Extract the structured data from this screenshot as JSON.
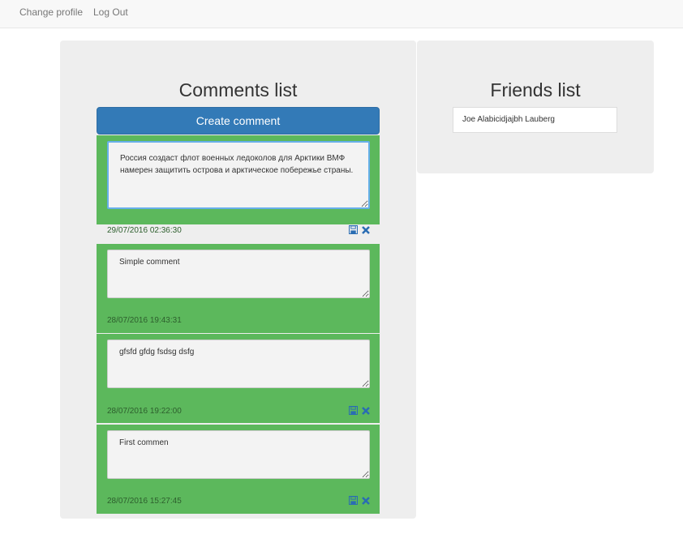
{
  "nav": {
    "change_profile": "Change profile",
    "log_out": "Log Out"
  },
  "comments_panel": {
    "title": "Comments list",
    "create_button": "Create comment",
    "items": [
      {
        "text": "Россия создаст флот военных ледоколов для Арктики ВМФ намерен защитить острова и арктическое побережье страны.",
        "date": "29/07/2016 02:36:30",
        "editable": true
      },
      {
        "text": "Simple comment",
        "date": "28/07/2016 19:43:31",
        "editable": false
      },
      {
        "text": "gfsfd gfdg fsdsg dsfg",
        "date": "28/07/2016 19:22:00",
        "editable": true
      },
      {
        "text": "First commen",
        "date": "28/07/2016 15:27:45",
        "editable": true
      }
    ]
  },
  "friends_panel": {
    "title": "Friends list",
    "items": [
      {
        "name": "Joe Alabicidjajbh Lauberg"
      }
    ]
  },
  "icons": {
    "save": "floppy-disk-icon",
    "delete": "close-icon"
  },
  "colors": {
    "primary": "#337ab7",
    "success": "#5cb85c",
    "panel_bg": "#eeeeee",
    "icon": "#2a6db3"
  }
}
